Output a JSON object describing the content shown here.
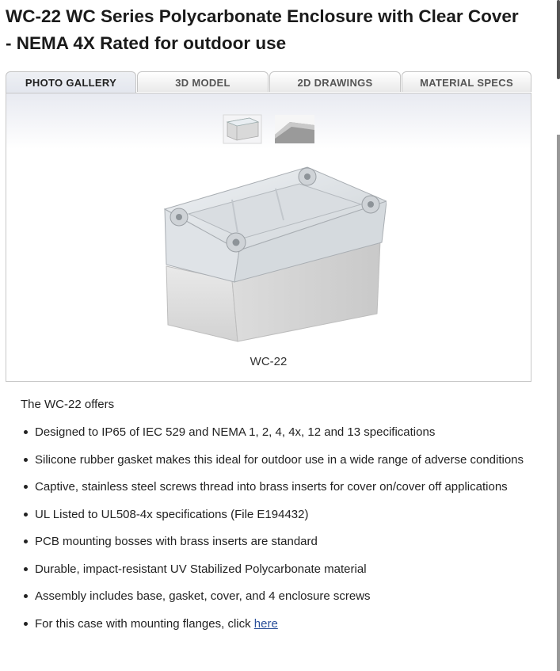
{
  "product": {
    "title": "WC-22 WC Series Polycarbonate Enclosure with Clear Cover - NEMA 4X Rated for outdoor use"
  },
  "tabs": [
    {
      "label": "PHOTO GALLERY",
      "active": true
    },
    {
      "label": "3D MODEL",
      "active": false
    },
    {
      "label": "2D DRAWINGS",
      "active": false
    },
    {
      "label": "MATERIAL SPECS",
      "active": false
    }
  ],
  "gallery": {
    "thumbnails": [
      "enclosure-front-thumbnail",
      "enclosure-corner-thumbnail"
    ],
    "caption": "WC-22"
  },
  "description": {
    "intro": "The WC-22 offers",
    "features": [
      "Designed to IP65 of IEC 529 and NEMA 1, 2, 4, 4x, 12 and 13 specifications",
      "Silicone rubber gasket makes this ideal for outdoor use in a wide range of adverse conditions",
      "Captive, stainless steel screws thread into brass inserts for cover on/cover off applications",
      "UL Listed to UL508-4x specifications (File E194432)",
      "PCB mounting bosses with brass inserts are standard",
      "Durable, impact-resistant UV Stabilized Polycarbonate material",
      "Assembly includes base, gasket, cover, and 4 enclosure screws"
    ],
    "last_feature_prefix": "For this case with mounting flanges, click ",
    "last_feature_link": "here"
  },
  "colors": {
    "link": "#2a4f9a",
    "tab_border": "#c5c5c5"
  }
}
